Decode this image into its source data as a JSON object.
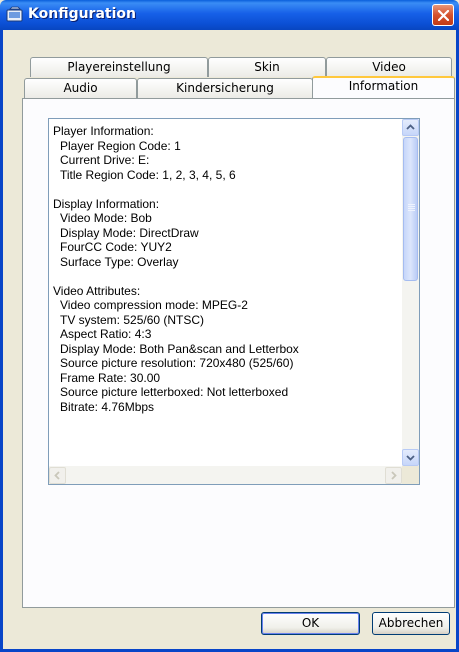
{
  "window": {
    "title": "Konfiguration"
  },
  "tabs": {
    "row1": [
      "Playereinstellung",
      "Skin",
      "Video"
    ],
    "row2": [
      "Audio",
      "Kindersicherung",
      "Information"
    ],
    "active": "Information"
  },
  "info_lines": [
    {
      "text": "Player Information:",
      "indent": false
    },
    {
      "text": "Player Region Code: 1",
      "indent": true
    },
    {
      "text": "Current Drive: E:",
      "indent": true
    },
    {
      "text": "Title Region Code: 1, 2, 3, 4, 5, 6",
      "indent": true
    },
    {
      "text": "",
      "indent": false
    },
    {
      "text": "Display Information:",
      "indent": false
    },
    {
      "text": "Video Mode: Bob",
      "indent": true
    },
    {
      "text": "Display Mode: DirectDraw",
      "indent": true
    },
    {
      "text": "FourCC Code: YUY2",
      "indent": true
    },
    {
      "text": "Surface Type: Overlay",
      "indent": true
    },
    {
      "text": "",
      "indent": false
    },
    {
      "text": "Video Attributes:",
      "indent": false
    },
    {
      "text": "Video compression mode: MPEG-2",
      "indent": true
    },
    {
      "text": "TV system: 525/60 (NTSC)",
      "indent": true
    },
    {
      "text": "Aspect Ratio: 4:3",
      "indent": true
    },
    {
      "text": "Display Mode: Both Pan&scan and Letterbox",
      "indent": true
    },
    {
      "text": "Source picture resolution: 720x480 (525/60)",
      "indent": true
    },
    {
      "text": "Frame Rate: 30.00",
      "indent": true
    },
    {
      "text": "Source picture letterboxed: Not letterboxed",
      "indent": true
    },
    {
      "text": "Bitrate: 4.76Mbps",
      "indent": true
    }
  ],
  "buttons": {
    "ok": "OK",
    "cancel": "Abbrechen"
  },
  "icons": {
    "title": "config-window-icon",
    "close": "close-icon",
    "scroll_up": "arrow-up-icon",
    "scroll_down": "arrow-down-icon",
    "scroll_left": "arrow-left-icon",
    "scroll_right": "arrow-right-icon"
  },
  "colors": {
    "titlebar": "#0A5FDB",
    "close": "#D5512C",
    "active_tab_highlight": "#FFC83C"
  }
}
